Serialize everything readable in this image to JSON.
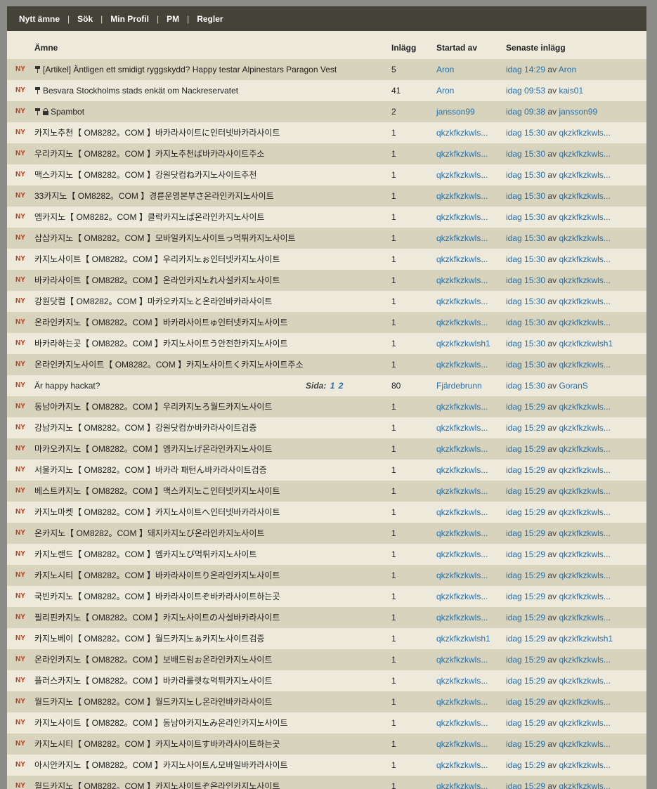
{
  "nav": [
    "Nytt ämne",
    "Sök",
    "Min Profil",
    "PM",
    "Regler"
  ],
  "nav_separator": "|",
  "columns": {
    "topic": "Ämne",
    "posts": "Inlägg",
    "started": "Startad av",
    "latest": "Senaste inlägg"
  },
  "new_badge": "NY",
  "by_word": "av",
  "pages_label": "Sida:",
  "colors": {
    "nav_bg": "#45423a",
    "row_light": "#edeadb",
    "row_dark": "#d8d3bc",
    "link": "#2a6fa8",
    "new_badge": "#b23c1c"
  },
  "topics": [
    {
      "title": "[Artikel] Äntligen ett smidigt ryggskydd? Happy testar Alpinestars Paragon Vest",
      "pinned": true,
      "locked": false,
      "posts": "5",
      "starter": "Aron",
      "time": "idag 14:29",
      "last_by": "Aron"
    },
    {
      "title": "Besvara Stockholms stads enkät om Nackreservatet",
      "pinned": true,
      "locked": false,
      "posts": "41",
      "starter": "Aron",
      "time": "idag 09:53",
      "last_by": "kais01"
    },
    {
      "title": "Spambot",
      "pinned": true,
      "locked": true,
      "posts": "2",
      "starter": "jansson99",
      "time": "idag 09:38",
      "last_by": "jansson99"
    },
    {
      "title": "카지노추천【 OM8282。COM 】바카라사이트に인터넷바카라사이트",
      "posts": "1",
      "starter": "qkzkfkzkwls...",
      "time": "idag 15:30",
      "last_by": "qkzkfkzkwls..."
    },
    {
      "title": "우리카지노【 OM8282。COM 】카지노추천ば바카라사이트주소",
      "posts": "1",
      "starter": "qkzkfkzkwls...",
      "time": "idag 15:30",
      "last_by": "qkzkfkzkwls..."
    },
    {
      "title": "맥스카지노【 OM8282。COM 】강원닷컴ね카지노사이트추천",
      "posts": "1",
      "starter": "qkzkfkzkwls...",
      "time": "idag 15:30",
      "last_by": "qkzkfkzkwls..."
    },
    {
      "title": "33카지노【 OM8282。COM 】경륜운영본부さ온라인카지노사이트",
      "posts": "1",
      "starter": "qkzkfkzkwls...",
      "time": "idag 15:30",
      "last_by": "qkzkfkzkwls..."
    },
    {
      "title": "엠카지노【 OM8282。COM 】클락카지노ば온라인카지노사이트",
      "posts": "1",
      "starter": "qkzkfkzkwls...",
      "time": "idag 15:30",
      "last_by": "qkzkfkzkwls..."
    },
    {
      "title": "삼삼카지노【 OM8282。COM 】모바일카지노사이트っ먹튀카지노사이트",
      "posts": "1",
      "starter": "qkzkfkzkwls...",
      "time": "idag 15:30",
      "last_by": "qkzkfkzkwls..."
    },
    {
      "title": "카지노사이트【 OM8282。COM 】우리카지노ぉ인터넷카지노사이트",
      "posts": "1",
      "starter": "qkzkfkzkwls...",
      "time": "idag 15:30",
      "last_by": "qkzkfkzkwls..."
    },
    {
      "title": "바카라사이트【 OM8282。COM 】온라인카지노れ사설카지노사이트",
      "posts": "1",
      "starter": "qkzkfkzkwls...",
      "time": "idag 15:30",
      "last_by": "qkzkfkzkwls..."
    },
    {
      "title": "강원닷컴【 OM8282。COM 】마카오카지노と온라인바카라사이트",
      "posts": "1",
      "starter": "qkzkfkzkwls...",
      "time": "idag 15:30",
      "last_by": "qkzkfkzkwls..."
    },
    {
      "title": "온라인카지노【 OM8282。COM 】바카라사이트ゅ인터넷카지노사이트",
      "posts": "1",
      "starter": "qkzkfkzkwls...",
      "time": "idag 15:30",
      "last_by": "qkzkfkzkwls..."
    },
    {
      "title": "바카라하는곳【 OM8282。COM 】카지노사이트う안전한카지노사이트",
      "posts": "1",
      "starter": "qkzkfkzkwlsh1",
      "time": "idag 15:30",
      "last_by": "qkzkfkzkwlsh1"
    },
    {
      "title": "온라인카지노사이트【 OM8282。COM 】카지노사이트く카지노사이트주소",
      "posts": "1",
      "starter": "qkzkfkzkwls...",
      "time": "idag 15:30",
      "last_by": "qkzkfkzkwls..."
    },
    {
      "title": "Är happy hackat?",
      "pages": [
        "1",
        "2"
      ],
      "posts": "80",
      "starter": "Fjärdebrunn",
      "time": "idag 15:30",
      "last_by": "GoranS"
    },
    {
      "title": "동남아카지노【 OM8282。COM 】우리카지노ろ월드카지노사이트",
      "posts": "1",
      "starter": "qkzkfkzkwls...",
      "time": "idag 15:29",
      "last_by": "qkzkfkzkwls..."
    },
    {
      "title": "강남카지노【 OM8282。COM 】강원닷컴か바카라사이트검증",
      "posts": "1",
      "starter": "qkzkfkzkwls...",
      "time": "idag 15:29",
      "last_by": "qkzkfkzkwls..."
    },
    {
      "title": "마카오카지노【 OM8282。COM 】엠카지노げ온라인카지노사이트",
      "posts": "1",
      "starter": "qkzkfkzkwls...",
      "time": "idag 15:29",
      "last_by": "qkzkfkzkwls..."
    },
    {
      "title": "서울카지노【 OM8282。COM 】바카라 패턴ん바카라사이트검증",
      "posts": "1",
      "starter": "qkzkfkzkwls...",
      "time": "idag 15:29",
      "last_by": "qkzkfkzkwls..."
    },
    {
      "title": "베스트카지노【 OM8282。COM 】맥스카지노こ인터넷카지노사이트",
      "posts": "1",
      "starter": "qkzkfkzkwls...",
      "time": "idag 15:29",
      "last_by": "qkzkfkzkwls..."
    },
    {
      "title": "카지노마켓【 OM8282。COM 】카지노사이트へ인터넷바카라사이트",
      "posts": "1",
      "starter": "qkzkfkzkwls...",
      "time": "idag 15:29",
      "last_by": "qkzkfkzkwls..."
    },
    {
      "title": "온카지노【 OM8282。COM 】돼지카지노び온라인카지노사이트",
      "posts": "1",
      "starter": "qkzkfkzkwls...",
      "time": "idag 15:29",
      "last_by": "qkzkfkzkwls..."
    },
    {
      "title": "카지노랜드【 OM8282。COM 】엠카지노び먹튀카지노사이트",
      "posts": "1",
      "starter": "qkzkfkzkwls...",
      "time": "idag 15:29",
      "last_by": "qkzkfkzkwls..."
    },
    {
      "title": "카지노시티【 OM8282。COM 】바카라사이트り온라인카지노사이트",
      "posts": "1",
      "starter": "qkzkfkzkwls...",
      "time": "idag 15:29",
      "last_by": "qkzkfkzkwls..."
    },
    {
      "title": "국빈카지노【 OM8282。COM 】바카라사이트ぞ바카라사이트하는곳",
      "posts": "1",
      "starter": "qkzkfkzkwls...",
      "time": "idag 15:29",
      "last_by": "qkzkfkzkwls..."
    },
    {
      "title": "필리핀카지노【 OM8282。COM 】카지노사이트の사설바카라사이트",
      "posts": "1",
      "starter": "qkzkfkzkwls...",
      "time": "idag 15:29",
      "last_by": "qkzkfkzkwls..."
    },
    {
      "title": "카지노베이【 OM8282。COM 】월드카지노ぁ카지노사이트검증",
      "posts": "1",
      "starter": "qkzkfkzkwlsh1",
      "time": "idag 15:29",
      "last_by": "qkzkfkzkwlsh1"
    },
    {
      "title": "온라인카지노【 OM8282。COM 】보배드림ぉ온라인카지노사이트",
      "posts": "1",
      "starter": "qkzkfkzkwls...",
      "time": "idag 15:29",
      "last_by": "qkzkfkzkwls..."
    },
    {
      "title": "플러스카지노【 OM8282。COM 】바카라룰렛な먹튀카지노사이트",
      "posts": "1",
      "starter": "qkzkfkzkwls...",
      "time": "idag 15:29",
      "last_by": "qkzkfkzkwls..."
    },
    {
      "title": "월드카지노【 OM8282。COM 】월드카지노し온라인바카라사이트",
      "posts": "1",
      "starter": "qkzkfkzkwls...",
      "time": "idag 15:29",
      "last_by": "qkzkfkzkwls..."
    },
    {
      "title": "카지노사이트【 OM8282。COM 】동남아카지노み온라인카지노사이트",
      "posts": "1",
      "starter": "qkzkfkzkwls...",
      "time": "idag 15:29",
      "last_by": "qkzkfkzkwls..."
    },
    {
      "title": "카지노시티【 OM8282。COM 】카지노사이트す바카라사이트하는곳",
      "posts": "1",
      "starter": "qkzkfkzkwls...",
      "time": "idag 15:29",
      "last_by": "qkzkfkzkwls..."
    },
    {
      "title": "아시안카지노【 OM8282。COM 】카지노사이트ん모바일바카라사이트",
      "posts": "1",
      "starter": "qkzkfkzkwls...",
      "time": "idag 15:29",
      "last_by": "qkzkfkzkwls..."
    },
    {
      "title": "월드카지노【 OM8282。COM 】카지노사이트ぞ온라인카지노사이트",
      "posts": "1",
      "starter": "qkzkfkzkwls...",
      "time": "idag 15:29",
      "last_by": "qkzkfkzkwls..."
    }
  ]
}
